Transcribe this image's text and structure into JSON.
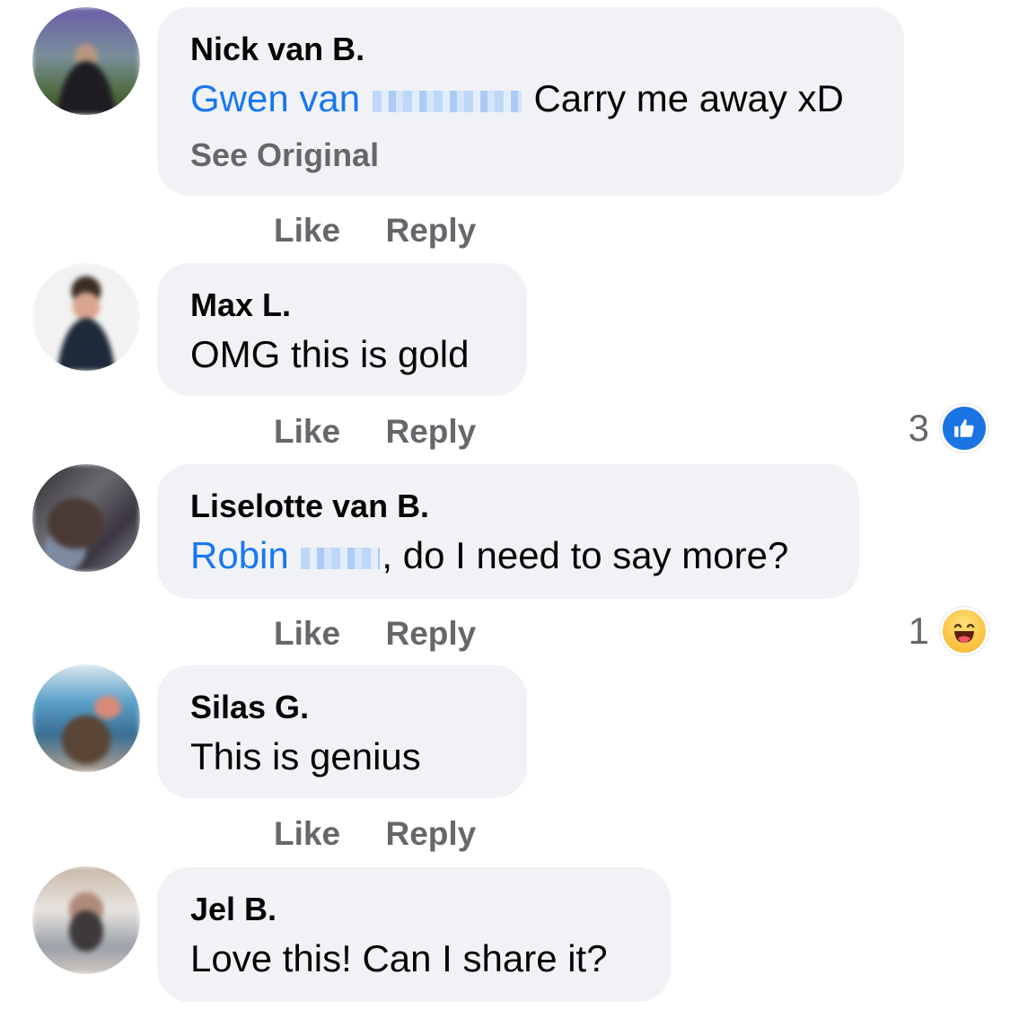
{
  "comments": [
    {
      "author": "Nick van B.",
      "mention": "Gwen van",
      "text_after": " Carry me away xD",
      "see_original": "See Original",
      "like": "Like",
      "reply": "Reply"
    },
    {
      "author": "Max L.",
      "text": "OMG this is gold",
      "like": "Like",
      "reply": "Reply",
      "reaction_count": "3",
      "reaction_icon": "like-thumb-icon"
    },
    {
      "author": "Liselotte van B.",
      "mention": "Robin",
      "text_after": ", do I need to say more?",
      "like": "Like",
      "reply": "Reply",
      "reaction_count": "1",
      "reaction_icon": "haha-emoji-icon"
    },
    {
      "author": "Silas G.",
      "text": "This is genius",
      "like": "Like",
      "reply": "Reply"
    },
    {
      "author": "Jel B.",
      "text": "Love this! Can I share it?"
    }
  ],
  "colors": {
    "bubble": "#f0f2f5",
    "mention": "#1877f2",
    "secondary_text": "#65676b",
    "like_blue": "#1b74e4"
  }
}
